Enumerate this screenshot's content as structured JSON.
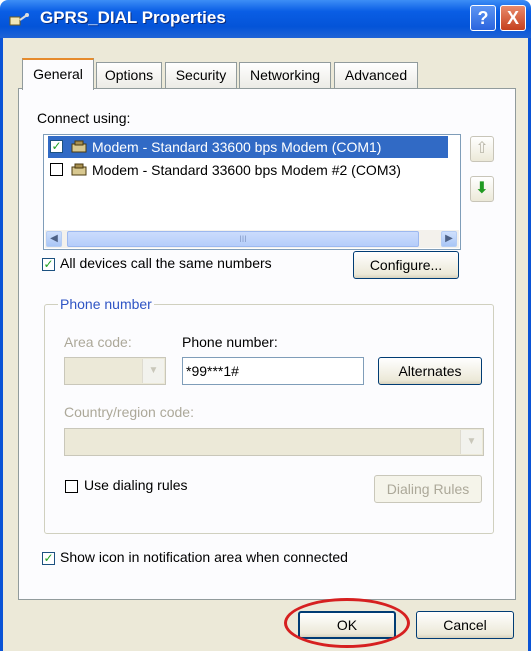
{
  "window": {
    "title": "GPRS_DIAL Properties",
    "help_glyph": "?",
    "close_glyph": "X"
  },
  "tabs": [
    {
      "label": "General",
      "active": true
    },
    {
      "label": "Options",
      "active": false
    },
    {
      "label": "Security",
      "active": false
    },
    {
      "label": "Networking",
      "active": false
    },
    {
      "label": "Advanced",
      "active": false
    }
  ],
  "general": {
    "connect_using_label": "Connect using:",
    "devices": [
      {
        "label": "Modem - Standard 33600 bps Modem (COM1)",
        "checked": true,
        "selected": true
      },
      {
        "label": "Modem - Standard 33600 bps Modem #2 (COM3)",
        "checked": false,
        "selected": false
      }
    ],
    "scroll_thumb_grip": "III",
    "all_devices_label": "All devices call the same numbers",
    "all_devices_checked": true,
    "configure_button": "Configure...",
    "phone_group_label": "Phone number",
    "area_code_label": "Area code:",
    "phone_number_label": "Phone number:",
    "phone_number_value": "*99***1#",
    "alternates_button": "Alternates",
    "country_label": "Country/region code:",
    "use_dialing_rules_label": "Use dialing rules",
    "use_dialing_rules_checked": false,
    "dialing_rules_button": "Dialing Rules",
    "show_icon_label": "Show icon in notification area when connected",
    "show_icon_checked": true
  },
  "footer": {
    "ok_button": "OK",
    "cancel_button": "Cancel"
  },
  "colors": {
    "titlebar": "#0454d8",
    "selection": "#316ac5",
    "dialog_bg": "#ece9d8",
    "highlight_circle": "#d62020"
  }
}
